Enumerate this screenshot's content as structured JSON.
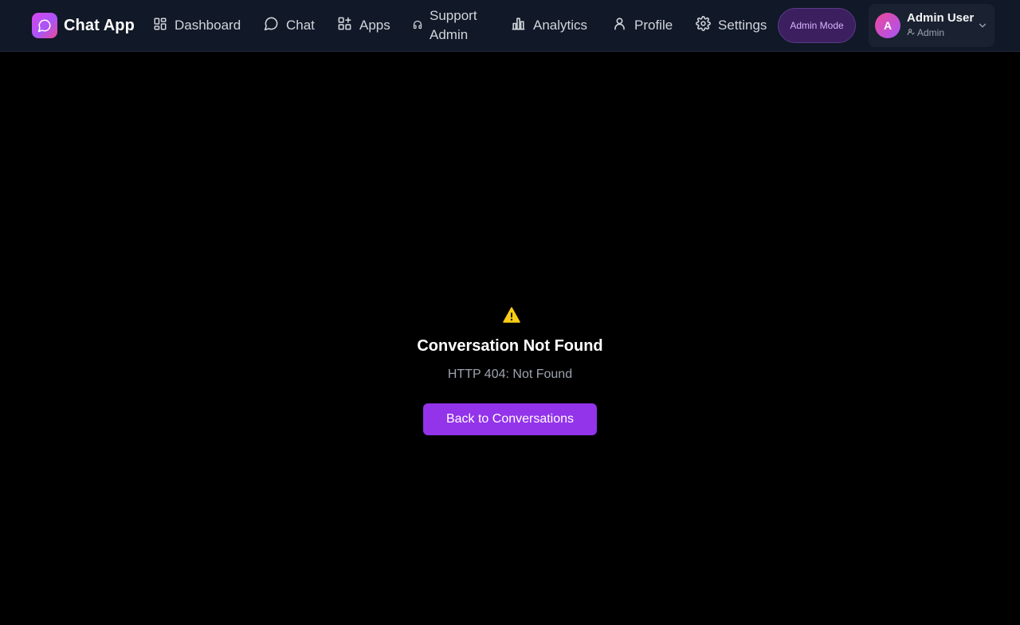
{
  "brand": {
    "name": "Chat App",
    "logo_icon": "chat-bubble-icon"
  },
  "nav": {
    "dashboard": "Dashboard",
    "chat": "Chat",
    "apps": "Apps",
    "support_line1": "Support",
    "support_line2": "Admin",
    "analytics": "Analytics",
    "profile": "Profile",
    "settings": "Settings"
  },
  "admin_mode_label": "Admin Mode",
  "user": {
    "avatar_initial": "A",
    "name": "Admin User",
    "role": "Admin"
  },
  "error": {
    "icon": "warning-icon",
    "title": "Conversation Not Found",
    "message": "HTTP 404: Not Found",
    "button_label": "Back to Conversations"
  },
  "colors": {
    "accent": "#9333ea",
    "header_bg": "#111827",
    "page_bg": "#000000",
    "warning": "#facc15"
  }
}
